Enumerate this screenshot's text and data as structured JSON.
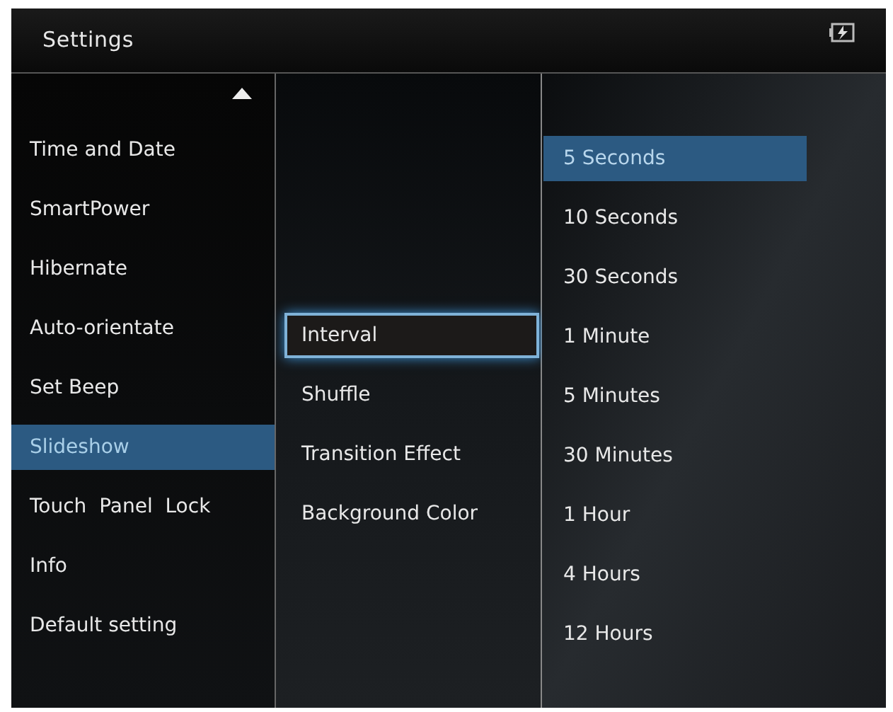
{
  "window": {
    "title": "Settings"
  },
  "menu": {
    "items": [
      {
        "label": "Time and Date",
        "selected": false
      },
      {
        "label": "SmartPower",
        "selected": false
      },
      {
        "label": "Hibernate",
        "selected": false
      },
      {
        "label": "Auto-orientate",
        "selected": false
      },
      {
        "label": "Set Beep",
        "selected": false
      },
      {
        "label": "Slideshow",
        "selected": true
      },
      {
        "label": "Touch  Panel  Lock",
        "selected": false
      },
      {
        "label": "Info",
        "selected": false
      },
      {
        "label": "Default setting",
        "selected": false
      }
    ]
  },
  "submenu": {
    "items": [
      {
        "label": "Interval",
        "selected": true
      },
      {
        "label": "Shuffle",
        "selected": false
      },
      {
        "label": "Transition Effect",
        "selected": false
      },
      {
        "label": "Background Color",
        "selected": false
      }
    ]
  },
  "options": {
    "items": [
      {
        "label": "5 Seconds",
        "selected": true
      },
      {
        "label": "10 Seconds",
        "selected": false
      },
      {
        "label": "30 Seconds",
        "selected": false
      },
      {
        "label": "1 Minute",
        "selected": false
      },
      {
        "label": "5 Minutes",
        "selected": false
      },
      {
        "label": "30 Minutes",
        "selected": false
      },
      {
        "label": "1 Hour",
        "selected": false
      },
      {
        "label": "4 Hours",
        "selected": false
      },
      {
        "label": "12 Hours",
        "selected": false
      }
    ]
  }
}
